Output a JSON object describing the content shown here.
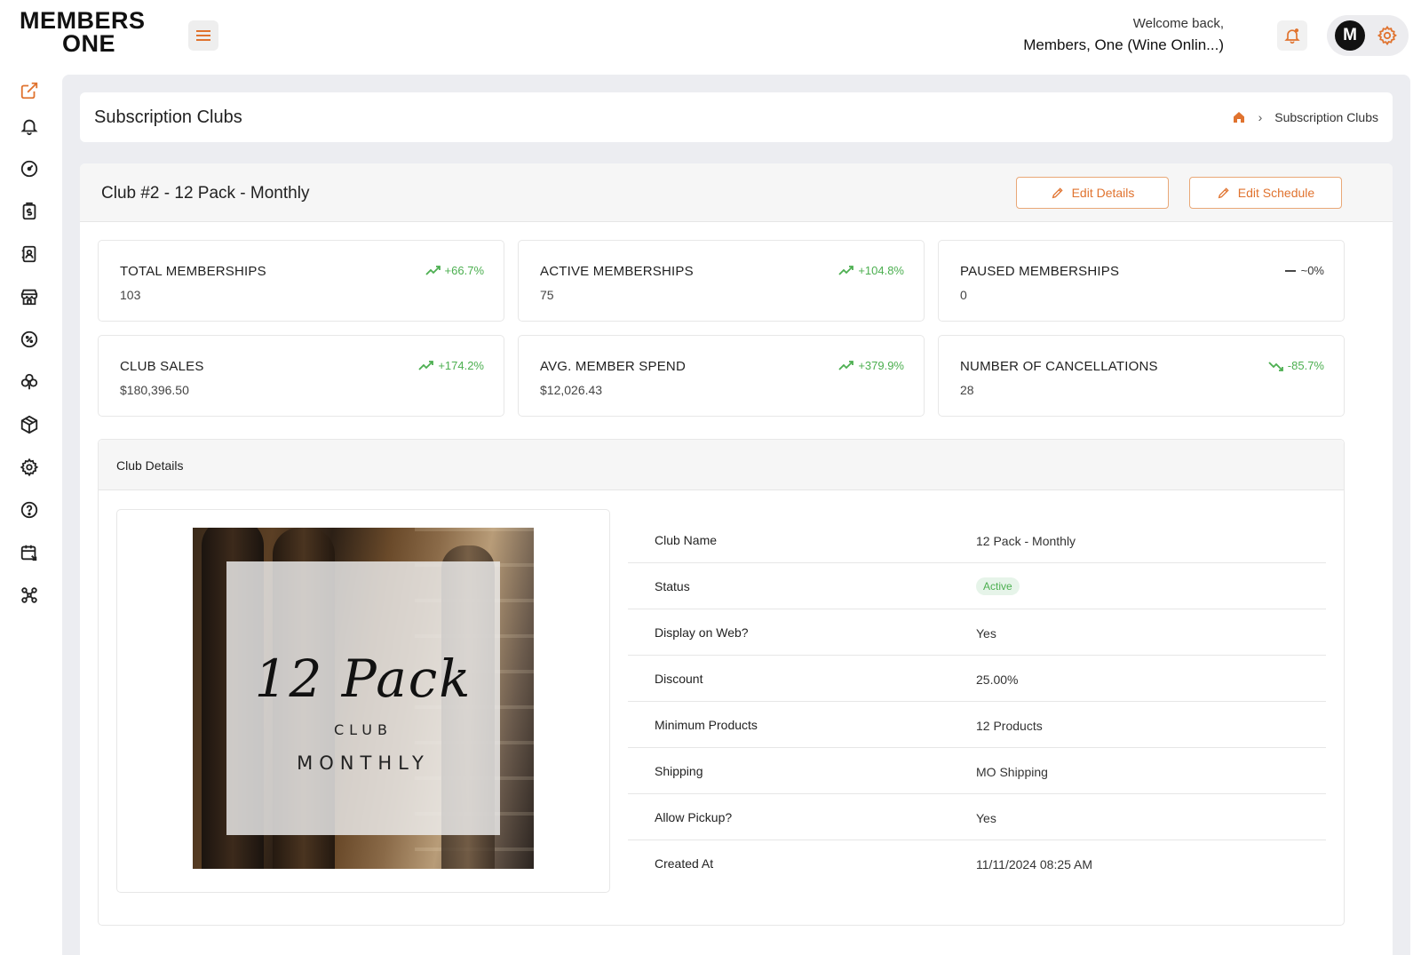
{
  "brand": {
    "logo_line1": "MEMBERS",
    "logo_line2": "ONE"
  },
  "header": {
    "welcome": "Welcome back,",
    "user_name": "Members, One (Wine Onlin...)",
    "avatar_initial": "M",
    "accent_color": "#e0732f"
  },
  "sidebar": {
    "items": [
      {
        "icon": "external-link-icon"
      },
      {
        "icon": "bell-icon"
      },
      {
        "icon": "dashboard-gauge-icon"
      },
      {
        "icon": "invoice-icon"
      },
      {
        "icon": "contacts-icon"
      },
      {
        "icon": "store-icon"
      },
      {
        "icon": "discount-icon"
      },
      {
        "icon": "club-icon"
      },
      {
        "icon": "package-icon"
      },
      {
        "icon": "settings-icon"
      },
      {
        "icon": "help-icon"
      },
      {
        "icon": "calendar-icon"
      },
      {
        "icon": "integrations-icon"
      }
    ]
  },
  "page": {
    "title": "Subscription Clubs",
    "breadcrumb": [
      "Subscription Clubs"
    ]
  },
  "club": {
    "title": "Club #2 - 12 Pack - Monthly",
    "edit_details": "Edit Details",
    "edit_schedule": "Edit Schedule"
  },
  "stats": [
    {
      "label": "TOTAL MEMBERSHIPS",
      "value": "103",
      "change": "+66.7%",
      "trend": "up",
      "color": "#4caf50"
    },
    {
      "label": "ACTIVE MEMBERSHIPS",
      "value": "75",
      "change": "+104.8%",
      "trend": "up",
      "color": "#4caf50"
    },
    {
      "label": "PAUSED MEMBERSHIPS",
      "value": "0",
      "change": "~0%",
      "trend": "flat",
      "color": "#333333"
    },
    {
      "label": "CLUB SALES",
      "value": "$180,396.50",
      "change": "+174.2%",
      "trend": "up",
      "color": "#4caf50"
    },
    {
      "label": "AVG. MEMBER SPEND",
      "value": "$12,026.43",
      "change": "+379.9%",
      "trend": "up",
      "color": "#4caf50"
    },
    {
      "label": "NUMBER OF CANCELLATIONS",
      "value": "28",
      "change": "-85.7%",
      "trend": "down",
      "color": "#4caf50"
    }
  ],
  "details": {
    "title": "Club Details",
    "image_text": {
      "script": "12 Pack",
      "club": "CLUB",
      "monthly": "MONTHLY"
    },
    "rows": [
      {
        "key": "Club Name",
        "value": "12 Pack - Monthly"
      },
      {
        "key": "Status",
        "value": "Active"
      },
      {
        "key": "Display on Web?",
        "value": "Yes"
      },
      {
        "key": "Discount",
        "value": "25.00%"
      },
      {
        "key": "Minimum Products",
        "value": "12 Products"
      },
      {
        "key": "Shipping",
        "value": "MO Shipping"
      },
      {
        "key": "Allow Pickup?",
        "value": "Yes"
      },
      {
        "key": "Created At",
        "value": "11/11/2024 08:25 AM"
      }
    ]
  }
}
